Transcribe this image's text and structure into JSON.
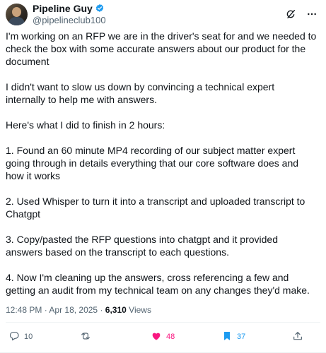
{
  "author": {
    "display_name": "Pipeline Guy",
    "handle": "@pipelineclub100",
    "verified": true,
    "avatar_icon": "avatar-photo"
  },
  "header_icons": [
    "grok-icon",
    "more-icon"
  ],
  "tweet": {
    "paragraphs": [
      "I'm working on an RFP we are in the driver's seat for and we needed to check the box with some accurate answers about our product for the document",
      "I didn't want to slow us down by convincing a technical expert internally to help me with answers.",
      "Here's what I did to finish in 2 hours:",
      "1. Found an 60 minute MP4 recording of our subject matter expert going through in details everything that our core software does and how it works",
      "2. Used Whisper to turn it into a transcript and uploaded transcript to Chatgpt",
      "3. Copy/pasted the RFP questions into chatgpt and it provided answers based on the transcript to each questions.",
      "4. Now I'm cleaning up the answers, cross referencing a few and getting an audit from my technical team on any changes they'd make."
    ]
  },
  "meta": {
    "time": "12:48 PM",
    "separator": "·",
    "date": "Apr 18, 2025",
    "views_count": "6,310",
    "views_label": "Views"
  },
  "actions": {
    "replies": "10",
    "reposts": "",
    "likes": "48",
    "bookmarks": "37"
  },
  "colors": {
    "verified": "#1d9bf0",
    "like": "#f91880",
    "bookmark": "#1d9bf0",
    "secondary_text": "#536471"
  }
}
